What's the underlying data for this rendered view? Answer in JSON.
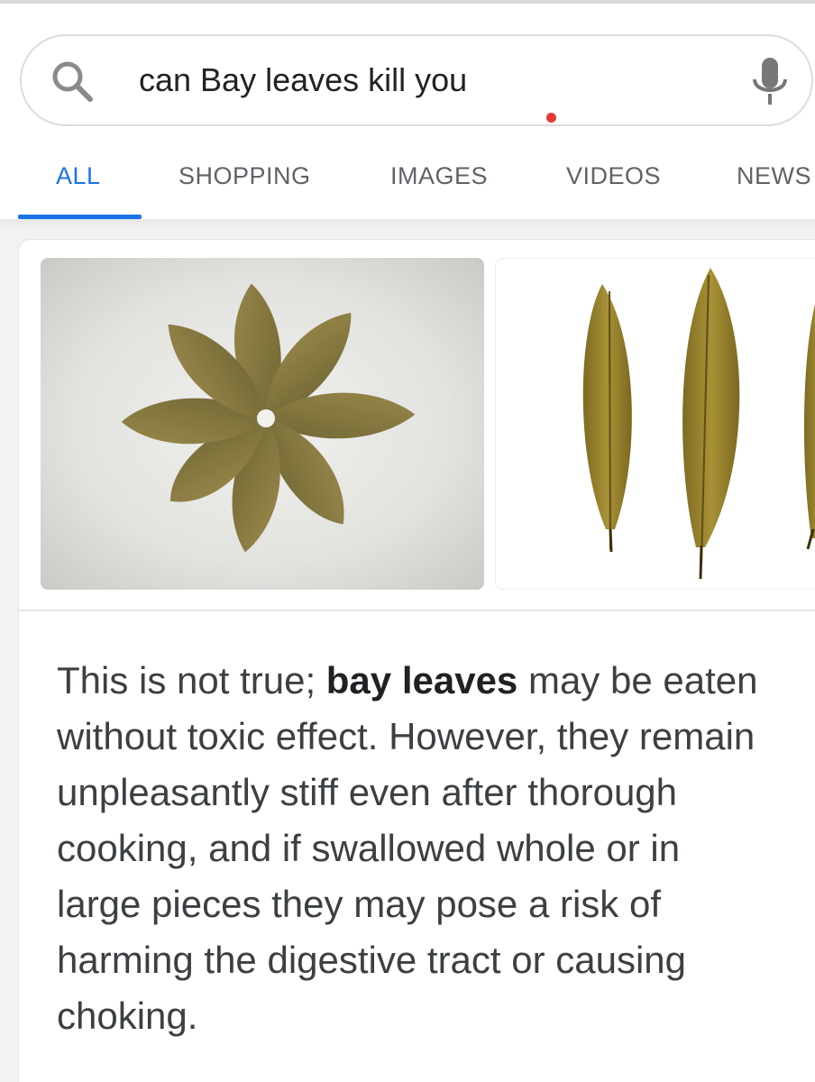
{
  "search": {
    "query": "can Bay leaves kill you",
    "icon": "search-icon",
    "voice_icon": "microphone-icon"
  },
  "tabs": [
    {
      "label": "ALL",
      "active": true
    },
    {
      "label": "SHOPPING",
      "active": false
    },
    {
      "label": "IMAGES",
      "active": false
    },
    {
      "label": "VIDEOS",
      "active": false
    },
    {
      "label": "NEWS",
      "active": false
    }
  ],
  "snippet": {
    "before": "This is not true; ",
    "bold": "bay leaves",
    "after": " may be eaten without toxic effect. However, they remain unpleasantly stiff even after thorough cooking, and if swallowed whole or in large pieces they may pose a risk of harming the digestive tract or causing choking."
  },
  "colors": {
    "accent": "#1a73e8",
    "tab_inactive": "#5f6368",
    "dot": "#e53935",
    "leaf": "#8a7a3c"
  }
}
